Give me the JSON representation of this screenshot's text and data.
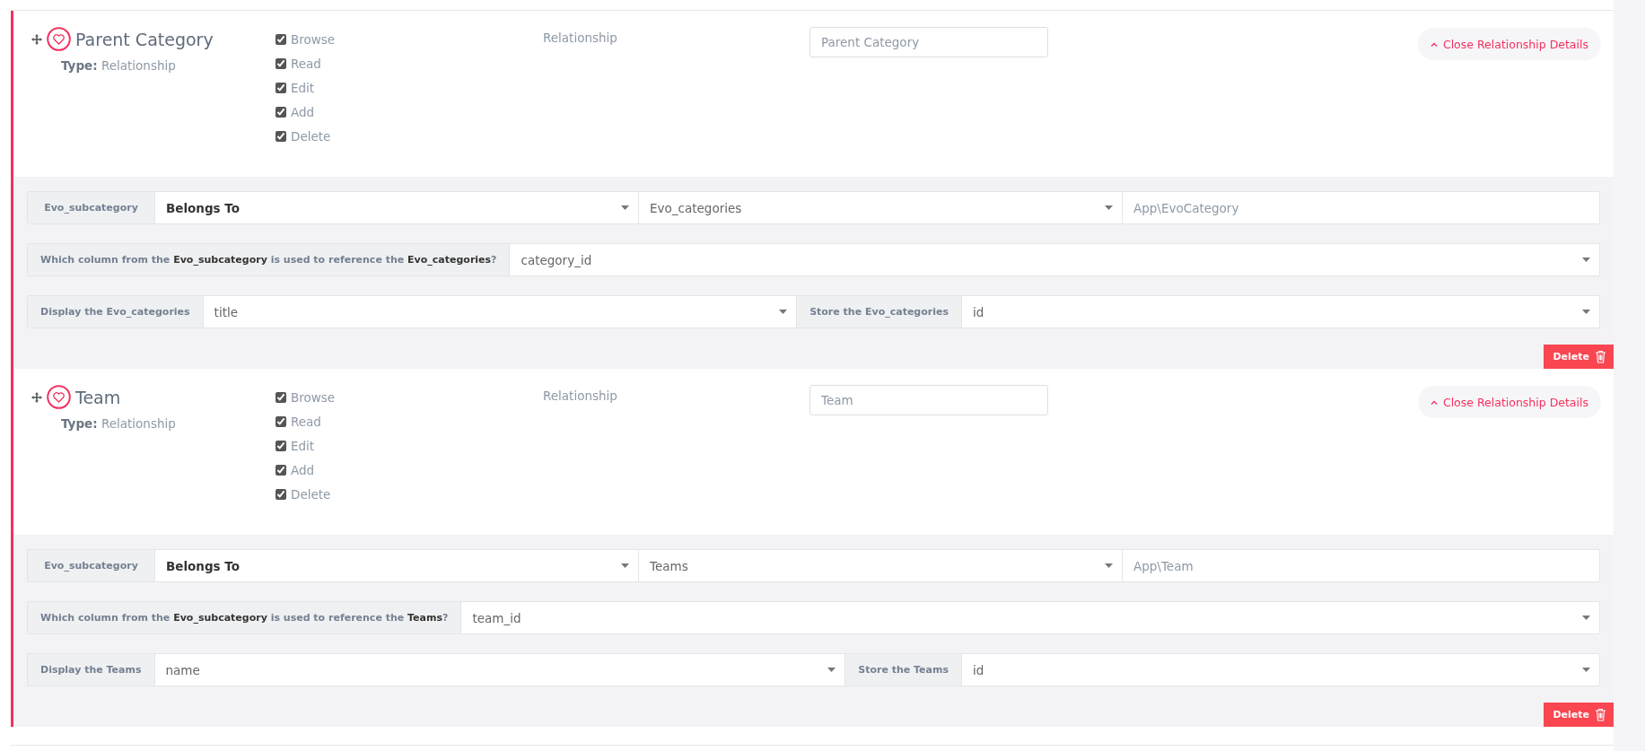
{
  "sections": [
    {
      "title": "Parent Category",
      "type_label": "Type:",
      "type_value": "Relationship",
      "permissions": [
        {
          "label": "Browse",
          "checked": true
        },
        {
          "label": "Read",
          "checked": true
        },
        {
          "label": "Edit",
          "checked": true
        },
        {
          "label": "Add",
          "checked": true
        },
        {
          "label": "Delete",
          "checked": true
        }
      ],
      "field_type": "Relationship",
      "display_name": "Parent Category",
      "close_button": "Close Relationship Details",
      "details": {
        "source": "Evo_subcategory",
        "relation_type": "Belongs To",
        "target_table": "Evo_categories",
        "model": "App\\EvoCategory",
        "column_question": "Which column from the **Evo_subcategory** is used to reference the **Evo_categories**?",
        "column_value": "category_id",
        "display_label": "Display the Evo_categories",
        "display_value": "title",
        "store_label": "Store the Evo_categories",
        "store_value": "id"
      },
      "delete_button": "Delete"
    },
    {
      "title": "Team",
      "type_label": "Type:",
      "type_value": "Relationship",
      "permissions": [
        {
          "label": "Browse",
          "checked": true
        },
        {
          "label": "Read",
          "checked": true
        },
        {
          "label": "Edit",
          "checked": true
        },
        {
          "label": "Add",
          "checked": true
        },
        {
          "label": "Delete",
          "checked": true
        }
      ],
      "field_type": "Relationship",
      "display_name": "Team",
      "close_button": "Close Relationship Details",
      "details": {
        "source": "Evo_subcategory",
        "relation_type": "Belongs To",
        "target_table": "Teams",
        "model": "App\\Team",
        "column_question": "Which column from the **Evo_subcategory** is used to reference the **Teams**?",
        "column_value": "team_id",
        "display_label": "Display the Teams",
        "display_value": "name",
        "store_label": "Store the Teams",
        "store_value": "id"
      },
      "delete_button": "Delete"
    }
  ]
}
